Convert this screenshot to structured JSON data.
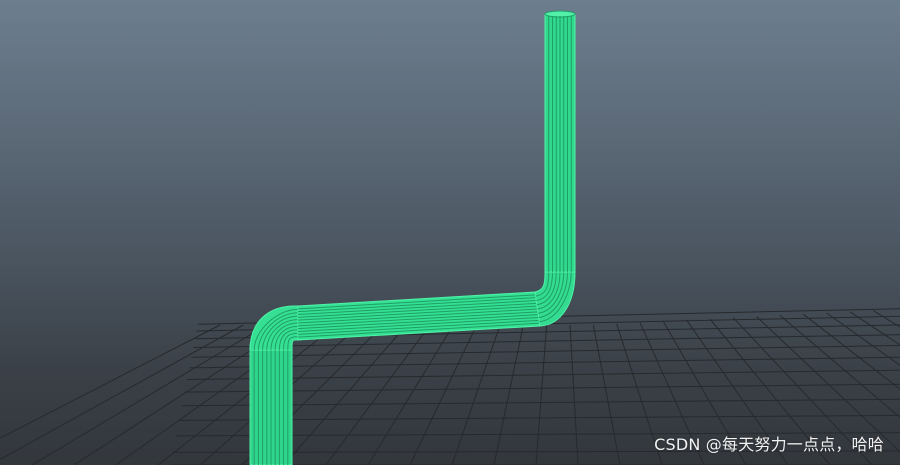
{
  "viewport": {
    "background_top": "#6d7e8e",
    "background_bottom": "#33373c",
    "grid_color": "#262a2e",
    "wireframe_color": "#3ee89a",
    "wireframe_edge_color": "#2bc884"
  },
  "watermark": {
    "text": "CSDN @每天努力一点点，哈哈"
  }
}
